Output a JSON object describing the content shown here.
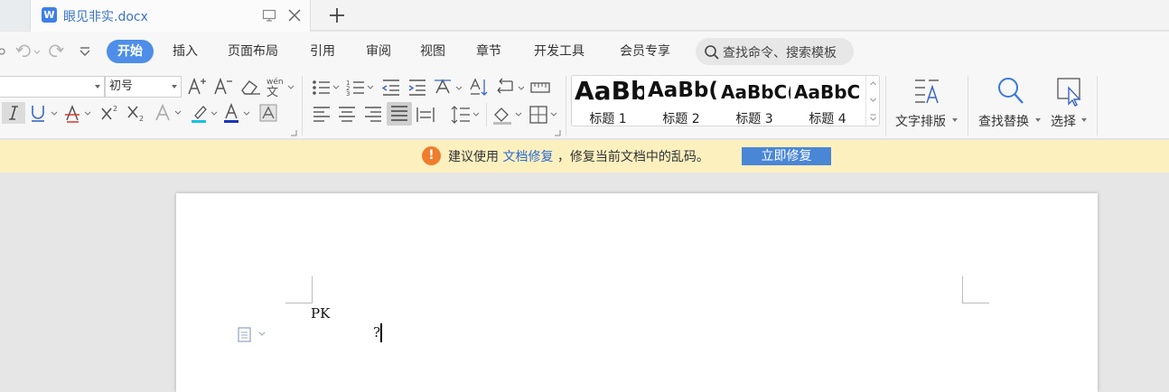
{
  "tab": {
    "title": "眼见非实.docx",
    "app_icon": "W"
  },
  "menu": {
    "items": [
      "开始",
      "插入",
      "页面布局",
      "引用",
      "审阅",
      "视图",
      "章节",
      "开发工具",
      "会员专享"
    ],
    "active": "开始"
  },
  "search": {
    "placeholder": "查找命令、搜索模板"
  },
  "ribbon": {
    "font_name": "",
    "font_size": "初号",
    "styles": [
      {
        "sample": "AaBb",
        "name": "标题 1"
      },
      {
        "sample": "AaBb(",
        "name": "标题 2"
      },
      {
        "sample": "AaBbC(",
        "name": "标题 3"
      },
      {
        "sample": "AaBbC",
        "name": "标题 4"
      }
    ],
    "text_layout_label": "文字排版",
    "find_replace_label": "查找替换",
    "select_label": "选择"
  },
  "notice": {
    "prefix": "建议使用",
    "link": "文档修复",
    "suffix": "，修复当前文档中的乱码。",
    "button": "立即修复"
  },
  "document": {
    "line1": "PK",
    "line2": "?"
  },
  "colors": {
    "accent": "#4e8ee8",
    "tab_title": "#3a74c9",
    "notice_bg": "#fdf0bf",
    "warning": "#ef7d2c",
    "fix_button": "#4a86d6"
  }
}
